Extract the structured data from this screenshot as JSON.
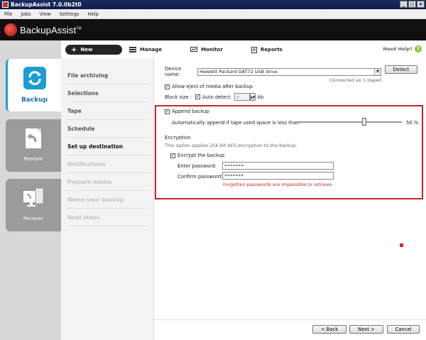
{
  "window": {
    "title": "BackupAssist 7.0.0b2t0"
  },
  "menu": [
    "File",
    "Jobs",
    "View",
    "Settings",
    "Help"
  ],
  "brand": {
    "name": "BackupAssist",
    "tm": "TM"
  },
  "tabs": {
    "new_label": "New",
    "manage_label": "Manage",
    "monitor_label": "Monitor",
    "reports_label": "Reports",
    "help_label": "Need Help?"
  },
  "nav": {
    "backup": "Backup",
    "restore": "Restore",
    "recover": "Recover"
  },
  "steps": [
    {
      "label": "File archiving",
      "state": "normal"
    },
    {
      "label": "Selections",
      "state": "normal"
    },
    {
      "label": "Tape",
      "state": "normal"
    },
    {
      "label": "Schedule",
      "state": "normal"
    },
    {
      "label": "Set up destination",
      "state": "current"
    },
    {
      "label": "Notifications",
      "state": "dim"
    },
    {
      "label": "Prepare media",
      "state": "dim"
    },
    {
      "label": "Name your backup",
      "state": "dim"
    },
    {
      "label": "Next steps",
      "state": "dim"
    }
  ],
  "device": {
    "label": "Device name:",
    "value": "Hewlett Packard DAT72 USB drive",
    "detect_label": "Detect",
    "connected": "Connected as \\\\.\\tape0",
    "eject_label": "Allow eject of media after backup",
    "blocksize_label": "Block size :",
    "autodetect_label": "Auto detect",
    "blocksize_value": "0",
    "blocksize_unit": "kb"
  },
  "append": {
    "label": "Append backup",
    "auto_label": "Automatically append if tape used space is less than",
    "percent": 50,
    "percent_text": "50 %"
  },
  "encryption": {
    "heading": "Encryption",
    "desc": "This option applies 256 bit AES encryption to the backup.",
    "encrypt_label": "Encrypt the backup",
    "enter_label": "Enter password:",
    "enter_value": "*******",
    "confirm_label": "Confirm password:",
    "confirm_value": "*******",
    "warning": "Forgotten passwords are impossible to retrieve."
  },
  "footer": {
    "back_label": "< Back",
    "next_label": "Next >",
    "cancel_label": "Cancel"
  },
  "colors": {
    "highlight": "#c8232c",
    "accent": "#1e9bd6"
  }
}
